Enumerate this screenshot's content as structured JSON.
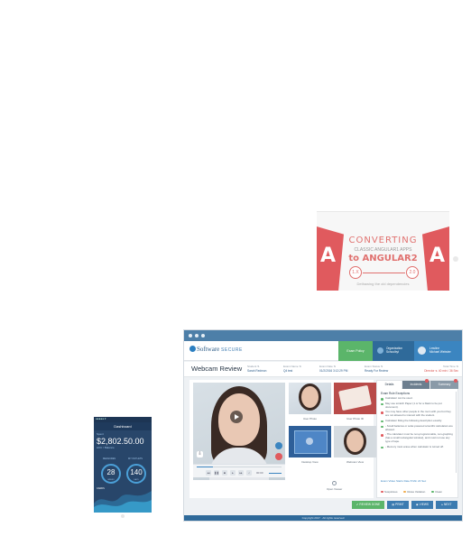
{
  "promo": {
    "title": "CONVERTING",
    "subtitle": "CLASSIC ANGULAR1 APPS",
    "target": "to ANGULAR2",
    "from_version": "1.X",
    "to_version": "2.0",
    "caption": "Dethawing the old dependencies",
    "shield_letter": "A"
  },
  "phone": {
    "status": "●●●●● ▾",
    "header": "Dashboard",
    "balance_label": "Spent",
    "balance": "$2,802.50.00",
    "balance_sub": "ACC / Balance",
    "stat1_label": "MEASURES",
    "stat1_value": "28",
    "stat1_caption": "WEEKS",
    "stat2_label": "MY OUTLETS",
    "stat2_value": "140",
    "stat2_caption": "DAYS",
    "cards_label": "CARDS"
  },
  "window": {
    "logo_brand": "Software",
    "logo_secure": "SECURE",
    "exam_policy": "Exam Policy",
    "org_label": "Organization",
    "org_name": "Schoolbyt",
    "user_label": "Lmsline",
    "user_name": "Michael Webster",
    "page_title": "Webcam Review",
    "fields": [
      {
        "label": "Student ⇅",
        "value": "Sarah Redmon"
      },
      {
        "label": "Exam Name ⇅",
        "value": "Q4 test"
      },
      {
        "label": "Exam Date ⇅",
        "value": "01/2/2016 3:12:29 PM"
      },
      {
        "label": "Exam Status ⇅",
        "value": "Ready For Review"
      }
    ],
    "total_time_label": "Total Time ⇅",
    "total_time_value": "Director ⇅  40 min / 36 Sec",
    "video_time": "00:00",
    "thumbs": [
      {
        "caption": "User Photo"
      },
      {
        "caption": "User Photo ID"
      },
      {
        "caption": "Desktop View"
      },
      {
        "caption": "Webcam View"
      }
    ],
    "open_viewer": "Open Viewer",
    "tabs": {
      "details": "Details",
      "incidents": "Incidents",
      "summary": "Summary"
    },
    "rules_heading": "Exam Rule Exceptions",
    "rules": [
      "Calculator can be used.",
      "May use scratch Paper (1 or for a blank to be put document).",
      "You may have other people in the room with you but they are not allowed to interact with the student.",
      "Calculator fitting the following description exactly:",
      "- Small batteries or solar-powered scientific calculators are allowed.",
      "- The calculator must be non-programmable, non-graphing (has a small rectangular window), and must not use any type of tape.",
      "- Memory must erase when calculator is turned off."
    ],
    "countdown": "Exam Video Starts Date 8 Min 24 Sec",
    "legend": [
      {
        "label": "Suspicious",
        "color": "#e05a5e"
      },
      {
        "label": "Rules Violation",
        "color": "#f0ad4e"
      },
      {
        "label": "Clean",
        "color": "#5bb56a"
      }
    ],
    "actions": {
      "review_done": "✔ REVIEW DONE",
      "print": "▤ PRINT",
      "views": "◉ VIEWS",
      "next": "▸ NEXT"
    },
    "footer": "Copyright 2017 · All rights reserved"
  }
}
